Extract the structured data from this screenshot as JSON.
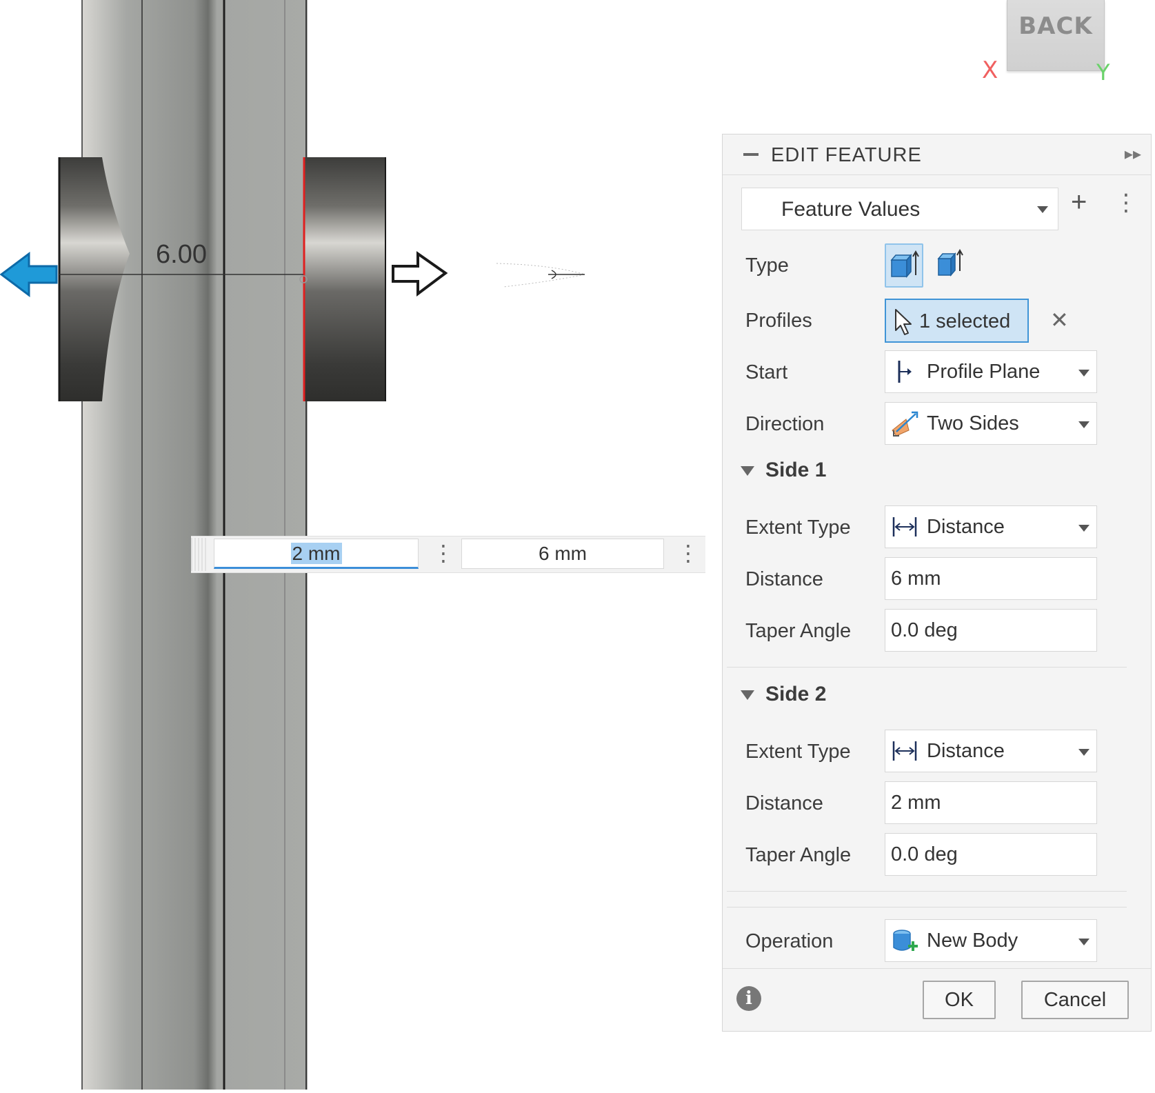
{
  "viewcube": {
    "face_label": "BACK",
    "axis_x": "X",
    "axis_y": "Y"
  },
  "canvas": {
    "dimension_label": "6.00",
    "inputs": {
      "side2_value": "2 mm",
      "side1_value": "6 mm"
    },
    "colors": {
      "body": "#9a9c9a",
      "cylinder": "#5a5a58",
      "selected_edge": "#e02020",
      "arrow_blue": "#1f9ad8"
    }
  },
  "panel": {
    "title": "EDIT FEATURE",
    "preset": "Feature Values",
    "labels": {
      "type": "Type",
      "profiles": "Profiles",
      "start": "Start",
      "direction": "Direction",
      "operation": "Operation"
    },
    "profiles_value": "1 selected",
    "start_value": "Profile Plane",
    "direction_value": "Two Sides",
    "side1": {
      "title": "Side 1",
      "extent_label": "Extent Type",
      "extent_value": "Distance",
      "distance_label": "Distance",
      "distance_value": "6 mm",
      "taper_label": "Taper Angle",
      "taper_value": "0.0 deg"
    },
    "side2": {
      "title": "Side 2",
      "extent_label": "Extent Type",
      "extent_value": "Distance",
      "distance_label": "Distance",
      "distance_value": "2 mm",
      "taper_label": "Taper Angle",
      "taper_value": "0.0 deg"
    },
    "operation_value": "New Body",
    "ok": "OK",
    "cancel": "Cancel",
    "accent_color": "#3f94d6"
  }
}
